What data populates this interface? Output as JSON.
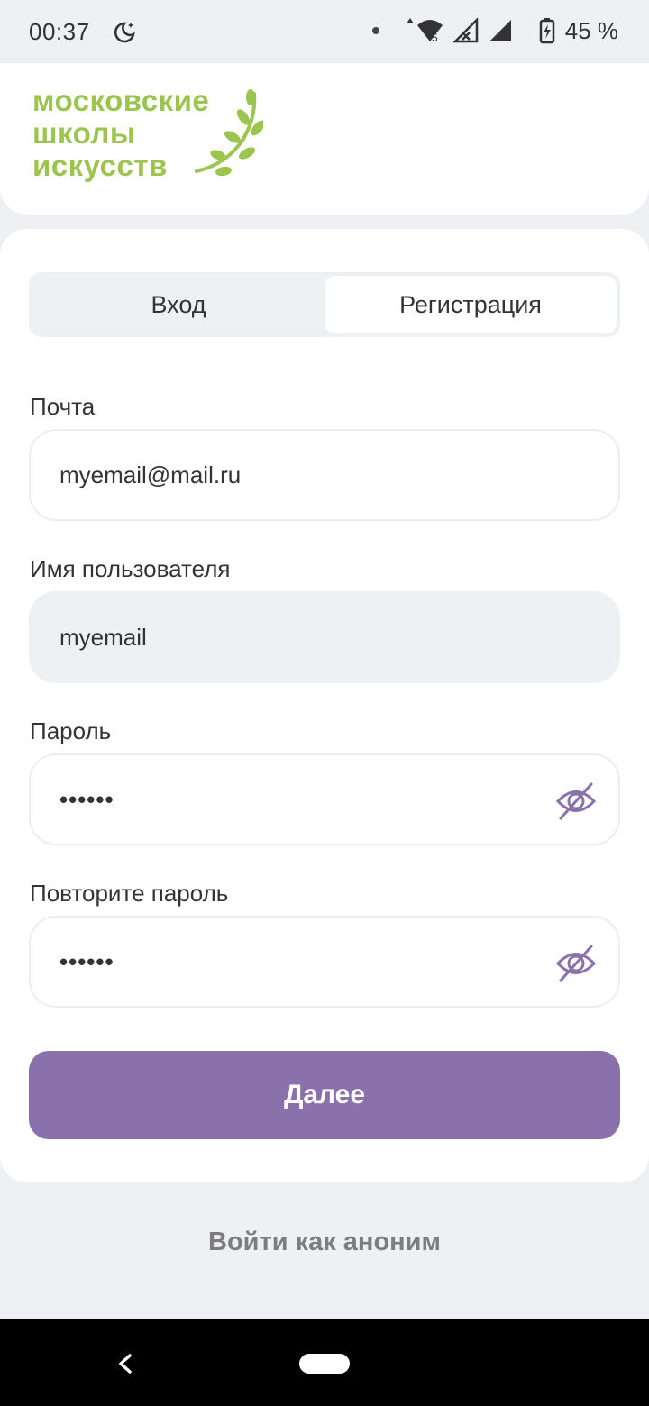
{
  "status_bar": {
    "time": "00:37",
    "battery": "45 %",
    "icons": [
      "moon-icon",
      "notification-dot-icon",
      "wifi-icon",
      "signal-icon",
      "battery-icon"
    ]
  },
  "logo": {
    "text": "московские\nшколы\nискусств",
    "color": "#9bc54f"
  },
  "tabs": {
    "login_label": "Вход",
    "register_label": "Регистрация",
    "active": "register"
  },
  "form": {
    "email": {
      "label": "Почта",
      "value": "myemail@mail.ru"
    },
    "username": {
      "label": "Имя пользователя",
      "value": "myemail"
    },
    "password": {
      "label": "Пароль",
      "value": "••••••"
    },
    "password_repeat": {
      "label": "Повторите пароль",
      "value": "••••••"
    }
  },
  "next_button_label": "Далее",
  "anon_link_label": "Войти как аноним",
  "colors": {
    "accent": "#8a71ab",
    "background": "#eff0f4"
  }
}
